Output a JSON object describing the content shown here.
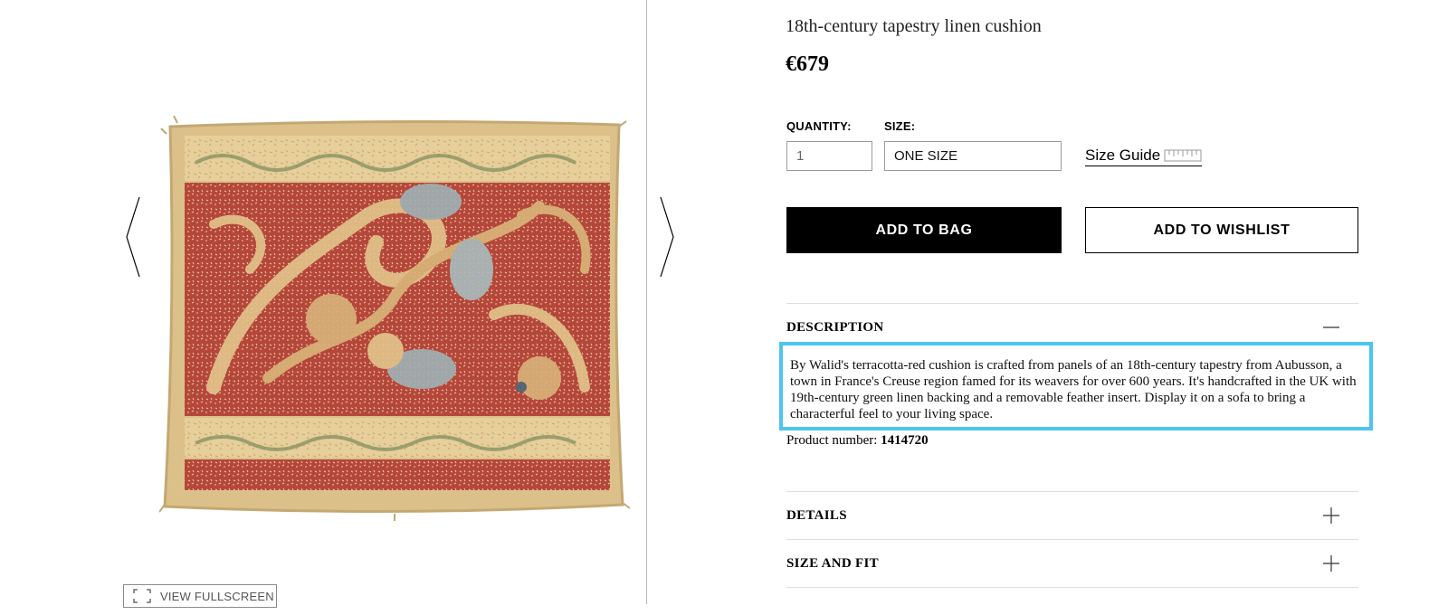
{
  "gallery": {
    "image_alt": "18th-century tapestry linen cushion",
    "prev_icon": "chevron-left-icon",
    "next_icon": "chevron-right-icon",
    "fullscreen_icon": "expand-icon",
    "fullscreen_label": "VIEW FULLSCREEN"
  },
  "product": {
    "title": "18th-century tapestry linen cushion",
    "price": "€679",
    "quantity_label": "QUANTITY:",
    "quantity_value": "1",
    "size_label": "SIZE:",
    "size_value": "ONE SIZE",
    "size_guide_label": "Size Guide",
    "size_guide_icon": "ruler-icon",
    "add_to_bag": "ADD TO BAG",
    "add_to_wishlist": "ADD TO WISHLIST"
  },
  "sections": {
    "description_title": "DESCRIPTION",
    "description_text": "By Walid's terracotta-red cushion is crafted from panels of an 18th-century tapestry from Aubusson, a town in France's Creuse region famed for its weavers for over 600 years. It's handcrafted in the UK with 19th-century green linen backing and a removable feather insert. Display it on a sofa to bring a characterful feel to your living space.",
    "product_number_label": "Product number:",
    "product_number": "1414720",
    "details_title": "DETAILS",
    "size_fit_title": "SIZE AND FIT"
  },
  "colors": {
    "highlight_border": "#4dc4ef",
    "cushion_red": "#b5473a",
    "cushion_cream": "#e6cf9a"
  }
}
